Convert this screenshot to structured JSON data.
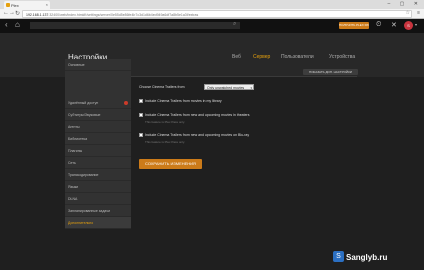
{
  "browser": {
    "tab_title": "Plex",
    "tab_close": "×",
    "window_buttons": "– ▢ ✕",
    "url_host": "192.168.1.137",
    "url_path": ":32400/web/index.html#!/settings/server/0e55d5e86fe4b7c3d1d6b4ed949a6df7a8b5e1a3f/extras"
  },
  "topbar": {
    "premium_label": "ПОЛУЧИТЬ PLEX PASS",
    "avatar_letter": "S"
  },
  "header": {
    "title": "Настройки",
    "tabs": [
      "Веб",
      "Сервер",
      "Пользователи",
      "Устройства"
    ],
    "active_tab": "Сервер",
    "server_name": "TEST-PLEX ▾",
    "advanced_button": "ПОКАЗАТЬ ДОП. НАСТРОЙКИ"
  },
  "sidebar": {
    "items": [
      {
        "label": "Основные"
      },
      {
        "label": "Удалённый доступ"
      },
      {
        "label": "Субтитры/Звуковые"
      },
      {
        "label": "Агенты"
      },
      {
        "label": "Библиотека"
      },
      {
        "label": "Плагины"
      },
      {
        "label": "Сеть"
      },
      {
        "label": "Транскодирование"
      },
      {
        "label": "Языки"
      },
      {
        "label": "DLNA"
      },
      {
        "label": "Запланированные задачи"
      },
      {
        "label": "Дополнительно"
      }
    ],
    "active_index": 11,
    "warning_index": 1
  },
  "content": {
    "trailer_from_label": "Choose Cinema Trailers from",
    "trailer_from_value": "Only unwatched movies",
    "dropdown_arrow": "▾",
    "option1": "Include Cinema Trailers from movies in my library",
    "option2": "Include Cinema Trailers from new and upcoming movies in theaters",
    "option2_help": "This feature is Plex Pass only.",
    "option3": "Include Cinema Trailers from new and upcoming movies on Blu-ray",
    "option3_help": "This feature is Plex Pass only.",
    "save_button": "СОХРАНИТЬ ИЗМЕНЕНИЯ"
  },
  "watermark": {
    "text": "Sanglyb.ru"
  }
}
